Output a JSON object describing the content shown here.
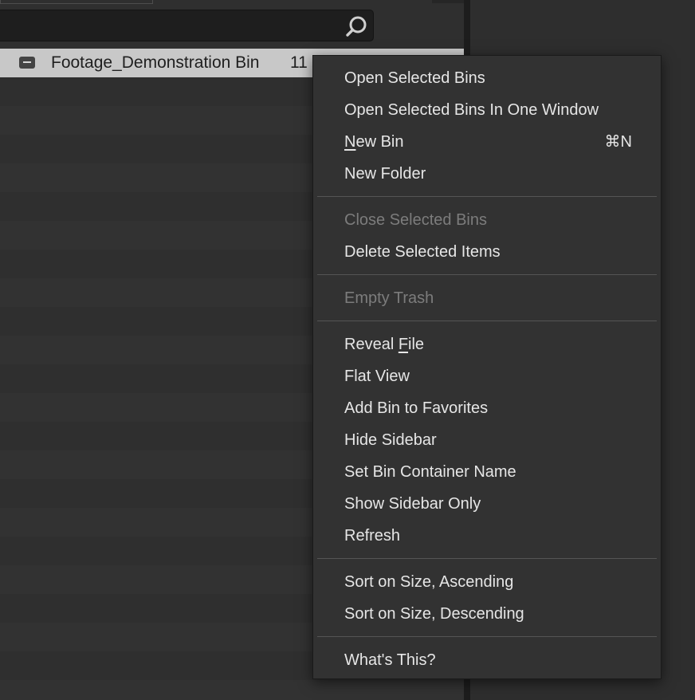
{
  "bin_panel": {
    "search_placeholder": "",
    "selected_bin": {
      "name": "Footage_Demonstration Bin",
      "count": "11"
    }
  },
  "context_menu": {
    "groups": [
      [
        {
          "before": "Open Selected Bins",
          "mnemonic": "",
          "after": "",
          "shortcut": "",
          "enabled": true
        },
        {
          "before": "Open Selected Bins In One Window",
          "mnemonic": "",
          "after": "",
          "shortcut": "",
          "enabled": true
        },
        {
          "before": "",
          "mnemonic": "N",
          "after": "ew Bin",
          "shortcut": "⌘N",
          "enabled": true
        },
        {
          "before": "New Folder",
          "mnemonic": "",
          "after": "",
          "shortcut": "",
          "enabled": true
        }
      ],
      [
        {
          "before": "Close Selected Bins",
          "mnemonic": "",
          "after": "",
          "shortcut": "",
          "enabled": false
        },
        {
          "before": "Delete Selected Items",
          "mnemonic": "",
          "after": "",
          "shortcut": "",
          "enabled": true
        }
      ],
      [
        {
          "before": "Empty Trash",
          "mnemonic": "",
          "after": "",
          "shortcut": "",
          "enabled": false
        }
      ],
      [
        {
          "before": "Reveal ",
          "mnemonic": "F",
          "after": "ile",
          "shortcut": "",
          "enabled": true
        },
        {
          "before": "Flat View",
          "mnemonic": "",
          "after": "",
          "shortcut": "",
          "enabled": true
        },
        {
          "before": "Add Bin to Favorites",
          "mnemonic": "",
          "after": "",
          "shortcut": "",
          "enabled": true
        },
        {
          "before": "Hide Sidebar",
          "mnemonic": "",
          "after": "",
          "shortcut": "",
          "enabled": true
        },
        {
          "before": "Set Bin Container Name",
          "mnemonic": "",
          "after": "",
          "shortcut": "",
          "enabled": true
        },
        {
          "before": "Show Sidebar Only",
          "mnemonic": "",
          "after": "",
          "shortcut": "",
          "enabled": true
        },
        {
          "before": "Refresh",
          "mnemonic": "",
          "after": "",
          "shortcut": "",
          "enabled": true
        }
      ],
      [
        {
          "before": "Sort on Size, Ascending",
          "mnemonic": "",
          "after": "",
          "shortcut": "",
          "enabled": true
        },
        {
          "before": "Sort on Size, Descending",
          "mnemonic": "",
          "after": "",
          "shortcut": "",
          "enabled": true
        }
      ],
      [
        {
          "before": "What's This?",
          "mnemonic": "",
          "after": "",
          "shortcut": "",
          "enabled": true
        }
      ]
    ]
  },
  "icons": {
    "search": "search-icon",
    "collapse": "collapse-icon"
  },
  "colors": {
    "menu_bg": "#323232",
    "menu_text": "#e6e6e6",
    "menu_disabled_text": "#7c7c7c",
    "selection_row": "#c8c8c8"
  }
}
